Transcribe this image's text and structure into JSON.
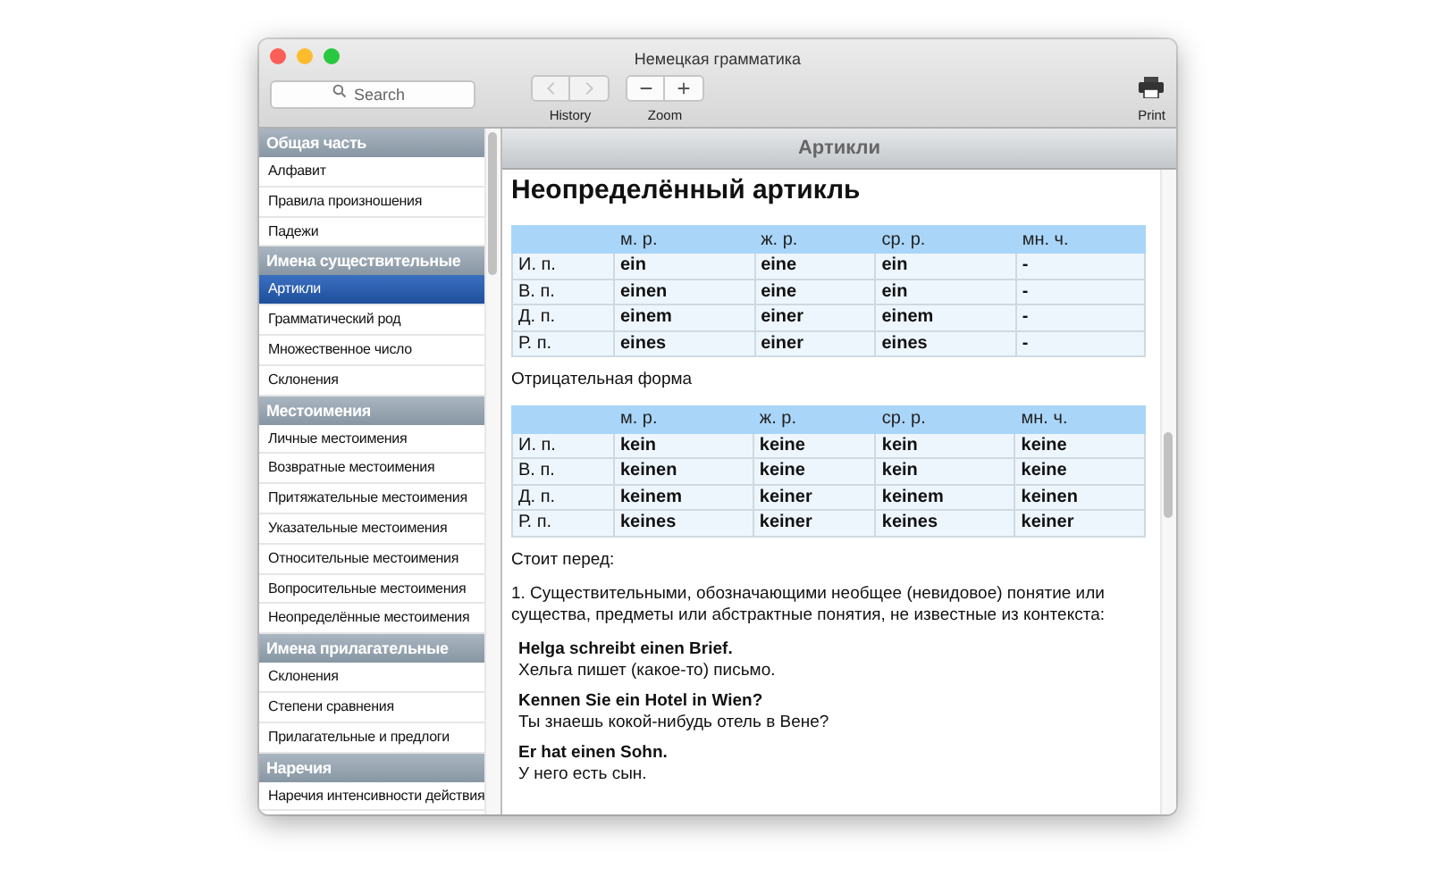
{
  "window": {
    "title": "Немецкая грамматика"
  },
  "toolbar": {
    "search": {
      "placeholder": "Search"
    },
    "groups": [
      {
        "label": "History",
        "buttons": [
          {
            "kind": "back",
            "disabled": true
          },
          {
            "kind": "forward",
            "disabled": true
          }
        ]
      },
      {
        "label": "Zoom",
        "buttons": [
          {
            "kind": "zoom_out",
            "disabled": false
          },
          {
            "kind": "zoom_in",
            "disabled": false
          }
        ]
      }
    ],
    "print": {
      "label": "Print"
    }
  },
  "sidebar": {
    "sections": [
      {
        "title": "Общая часть",
        "items": [
          {
            "label": "Алфавит",
            "selected": false
          },
          {
            "label": "Правила произношения",
            "selected": false
          },
          {
            "label": "Падежи",
            "selected": false
          }
        ]
      },
      {
        "title": "Имена существительные",
        "items": [
          {
            "label": "Артикли",
            "selected": true
          },
          {
            "label": "Грамматический род",
            "selected": false
          },
          {
            "label": "Множественное число",
            "selected": false
          },
          {
            "label": "Склонения",
            "selected": false
          }
        ]
      },
      {
        "title": "Местоимения",
        "items": [
          {
            "label": "Личные местоимения",
            "selected": false
          },
          {
            "label": "Возвратные местоимения",
            "selected": false
          },
          {
            "label": "Притяжательные местоимения",
            "selected": false
          },
          {
            "label": "Указательные местоимения",
            "selected": false
          },
          {
            "label": "Относительные местоимения",
            "selected": false
          },
          {
            "label": "Вопросительные местоимения",
            "selected": false
          },
          {
            "label": "Неопределённые местоимения",
            "selected": false
          }
        ]
      },
      {
        "title": "Имена прилагательные",
        "items": [
          {
            "label": "Склонения",
            "selected": false
          },
          {
            "label": "Степени сравнения",
            "selected": false
          },
          {
            "label": "Прилагательные и предлоги",
            "selected": false
          }
        ]
      },
      {
        "title": "Наречия",
        "items": [
          {
            "label": "Наречия интенсивности действия",
            "selected": false
          }
        ]
      }
    ]
  },
  "content": {
    "header": "Артикли",
    "title": "Неопределённый артикль",
    "blocks": [
      {
        "kind": "table",
        "columns": [
          "м. р.",
          "ж. р.",
          "ср. р.",
          "мн. ч."
        ],
        "rows": [
          {
            "label": "И. п.",
            "cells": [
              "ein",
              "eine",
              "ein",
              "-"
            ]
          },
          {
            "label": "В. п.",
            "cells": [
              "einen",
              "eine",
              "ein",
              "-"
            ]
          },
          {
            "label": "Д. п.",
            "cells": [
              "einem",
              "einer",
              "einem",
              "-"
            ]
          },
          {
            "label": "Р. п.",
            "cells": [
              "eines",
              "einer",
              "eines",
              "-"
            ]
          }
        ]
      },
      {
        "kind": "text",
        "text": "Отрицательная форма"
      },
      {
        "kind": "table",
        "columns": [
          "м. р.",
          "ж. р.",
          "ср. р.",
          "мн. ч."
        ],
        "rows": [
          {
            "label": "И. п.",
            "cells": [
              "kein",
              "keine",
              "kein",
              "keine"
            ]
          },
          {
            "label": "В. п.",
            "cells": [
              "keinen",
              "keine",
              "kein",
              "keine"
            ]
          },
          {
            "label": "Д. п.",
            "cells": [
              "keinem",
              "keiner",
              "keinem",
              "keinen"
            ]
          },
          {
            "label": "Р. п.",
            "cells": [
              "keines",
              "keiner",
              "keines",
              "keiner"
            ]
          }
        ]
      },
      {
        "kind": "text",
        "text": "Стоит перед:"
      },
      {
        "kind": "text",
        "text": "1. Существительными, обозначающими необщее (невидовое) понятие или существа, предметы или абстрактные понятия, не известные из контекста:"
      },
      {
        "kind": "example",
        "de": "Helga schreibt einen Brief.",
        "ru": "Хельга пишет (какое-то) письмо."
      },
      {
        "kind": "example",
        "de": "Kennen Sie ein Hotel in Wien?",
        "ru": "Ты знаешь кокой-нибудь отель в Вене?"
      },
      {
        "kind": "example",
        "de": "Er hat einen Sohn.",
        "ru": "У него есть сын."
      }
    ]
  }
}
